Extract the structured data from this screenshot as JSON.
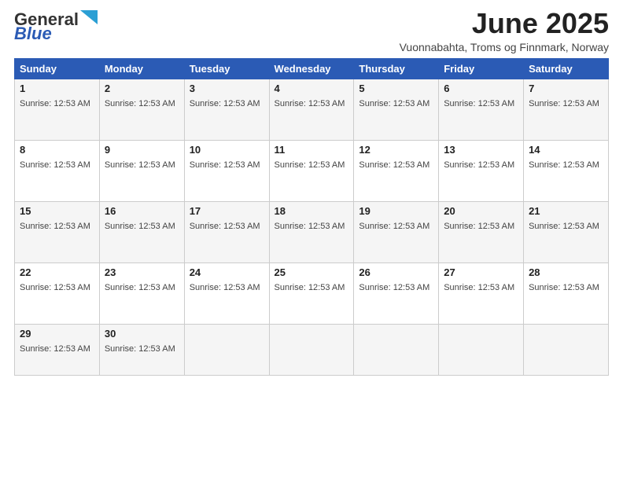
{
  "logo": {
    "line1": "General",
    "line2": "Blue"
  },
  "header": {
    "month_year": "June 2025",
    "location": "Vuonnabahta, Troms og Finnmark, Norway"
  },
  "days_of_week": [
    "Sunday",
    "Monday",
    "Tuesday",
    "Wednesday",
    "Thursday",
    "Friday",
    "Saturday"
  ],
  "sunrise_label": "Sunrise: 12:53 AM",
  "weeks": [
    [
      {
        "day": "1",
        "sunrise": "Sunrise: 12:53 AM"
      },
      {
        "day": "2",
        "sunrise": "Sunrise: 12:53 AM"
      },
      {
        "day": "3",
        "sunrise": "Sunrise: 12:53 AM"
      },
      {
        "day": "4",
        "sunrise": "Sunrise: 12:53 AM"
      },
      {
        "day": "5",
        "sunrise": "Sunrise: 12:53 AM"
      },
      {
        "day": "6",
        "sunrise": "Sunrise: 12:53 AM"
      },
      {
        "day": "7",
        "sunrise": "Sunrise: 12:53 AM"
      }
    ],
    [
      {
        "day": "8",
        "sunrise": "Sunrise: 12:53 AM"
      },
      {
        "day": "9",
        "sunrise": "Sunrise: 12:53 AM"
      },
      {
        "day": "10",
        "sunrise": "Sunrise: 12:53 AM"
      },
      {
        "day": "11",
        "sunrise": "Sunrise: 12:53 AM"
      },
      {
        "day": "12",
        "sunrise": "Sunrise: 12:53 AM"
      },
      {
        "day": "13",
        "sunrise": "Sunrise: 12:53 AM"
      },
      {
        "day": "14",
        "sunrise": "Sunrise: 12:53 AM"
      }
    ],
    [
      {
        "day": "15",
        "sunrise": "Sunrise: 12:53 AM"
      },
      {
        "day": "16",
        "sunrise": "Sunrise: 12:53 AM"
      },
      {
        "day": "17",
        "sunrise": "Sunrise: 12:53 AM"
      },
      {
        "day": "18",
        "sunrise": "Sunrise: 12:53 AM"
      },
      {
        "day": "19",
        "sunrise": "Sunrise: 12:53 AM"
      },
      {
        "day": "20",
        "sunrise": "Sunrise: 12:53 AM"
      },
      {
        "day": "21",
        "sunrise": "Sunrise: 12:53 AM"
      }
    ],
    [
      {
        "day": "22",
        "sunrise": "Sunrise: 12:53 AM"
      },
      {
        "day": "23",
        "sunrise": "Sunrise: 12:53 AM"
      },
      {
        "day": "24",
        "sunrise": "Sunrise: 12:53 AM"
      },
      {
        "day": "25",
        "sunrise": "Sunrise: 12:53 AM"
      },
      {
        "day": "26",
        "sunrise": "Sunrise: 12:53 AM"
      },
      {
        "day": "27",
        "sunrise": "Sunrise: 12:53 AM"
      },
      {
        "day": "28",
        "sunrise": "Sunrise: 12:53 AM"
      }
    ],
    [
      {
        "day": "29",
        "sunrise": "Sunrise: 12:53 AM"
      },
      {
        "day": "30",
        "sunrise": "Sunrise: 12:53 AM"
      },
      null,
      null,
      null,
      null,
      null
    ]
  ]
}
